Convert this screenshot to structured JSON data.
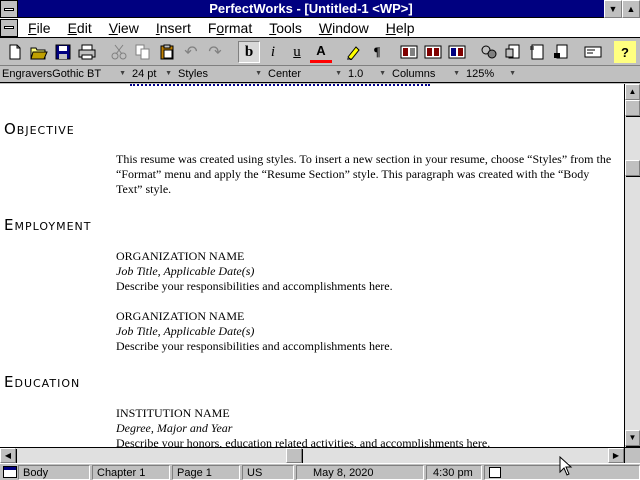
{
  "window": {
    "title": "PerfectWorks - [Untitled-1 <WP>]"
  },
  "menu": {
    "items": [
      {
        "label": "File",
        "ul": "F",
        "rest": "ile"
      },
      {
        "label": "Edit",
        "ul": "E",
        "rest": "dit"
      },
      {
        "label": "View",
        "ul": "V",
        "rest": "iew"
      },
      {
        "label": "Insert",
        "ul": "I",
        "rest": "nsert"
      },
      {
        "label": "Format",
        "ul": "F",
        "rest": "ormat",
        "alt_ul_index": 1
      },
      {
        "label": "Tools",
        "ul": "T",
        "rest": "ools"
      },
      {
        "label": "Window",
        "ul": "W",
        "rest": "indow"
      },
      {
        "label": "Help",
        "ul": "H",
        "rest": "elp"
      }
    ]
  },
  "toolbar": {
    "bold": "b",
    "italic": "i",
    "underline": "u",
    "color": "A",
    "pilcrow": "¶",
    "help": "?"
  },
  "formatbar": {
    "font": "EngraversGothic BT",
    "size": "24 pt",
    "style": "Styles",
    "alignment": "Center",
    "spacing": "1.0",
    "columns": "Columns",
    "zoom": "125%"
  },
  "document": {
    "sections": [
      {
        "heading": "Objective",
        "paragraph_lines": [
          "This resume was created using styles. To insert a new section in your resume, choose “Styles” from the",
          "“Format” menu and apply the “Resume Section” style. This paragraph was created with the “Body",
          "Text” style."
        ]
      },
      {
        "heading": "Employment",
        "entries": [
          {
            "name": "ORGANIZATION NAME",
            "subtitle": "Job Title, Applicable Date(s)",
            "desc": "Describe your responsibilities and accomplishments here."
          },
          {
            "name": "ORGANIZATION NAME",
            "subtitle": "Job Title, Applicable Date(s)",
            "desc": "Describe your responsibilities and accomplishments here."
          }
        ]
      },
      {
        "heading": "Education",
        "entries": [
          {
            "name": "INSTITUTION NAME",
            "subtitle": "Degree, Major and Year",
            "desc": "Describe your honors, education related activities, and accomplishments here."
          }
        ]
      }
    ]
  },
  "status": {
    "style": "Body",
    "chapter": "Chapter 1",
    "page": "Page 1",
    "language": "US",
    "date": "May 8, 2020",
    "time": "4:30 pm"
  },
  "colors": {
    "titlebar": "#000080",
    "link_underline": "#00008a"
  }
}
